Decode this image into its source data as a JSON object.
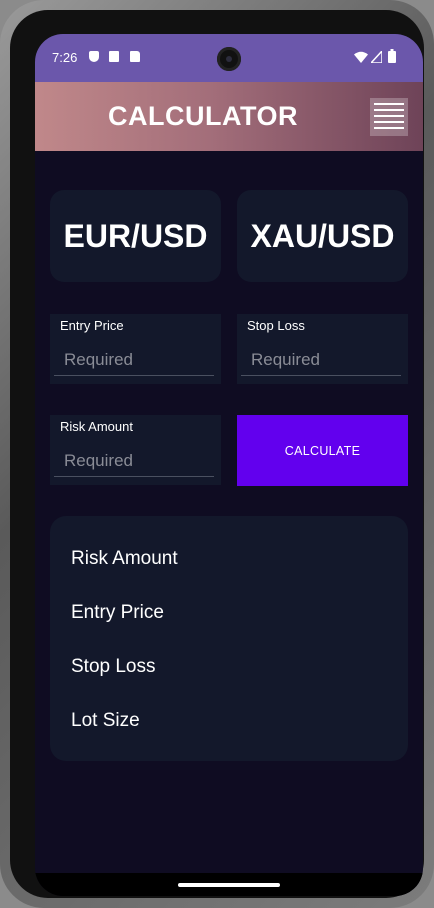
{
  "status_bar": {
    "time": "7:26",
    "left_icons": [
      "shield-icon",
      "a-icon",
      "sd-card-icon"
    ],
    "right_icons": [
      "wifi-icon",
      "signal-icon",
      "battery-icon"
    ]
  },
  "app_bar": {
    "title": "CALCULATOR",
    "menu_icon": "hamburger-menu-icon",
    "gradient_colors": [
      "#c0888a",
      "#6e4358"
    ]
  },
  "pairs": [
    {
      "label": "EUR/USD"
    },
    {
      "label": "XAU/USD"
    }
  ],
  "fields": {
    "entry_price": {
      "label": "Entry Price",
      "placeholder": "Required",
      "value": ""
    },
    "stop_loss": {
      "label": "Stop Loss",
      "placeholder": "Required",
      "value": ""
    },
    "risk_amount": {
      "label": "Risk Amount",
      "placeholder": "Required",
      "value": ""
    }
  },
  "calculate_button": {
    "label": "CALCULATE",
    "color": "#6200ee"
  },
  "results": [
    {
      "label": "Risk Amount"
    },
    {
      "label": "Entry Price"
    },
    {
      "label": "Stop Loss"
    },
    {
      "label": "Lot Size"
    }
  ],
  "colors": {
    "background": "#0f0c22",
    "card": "#13182b",
    "status_bar": "#6b57ab"
  }
}
